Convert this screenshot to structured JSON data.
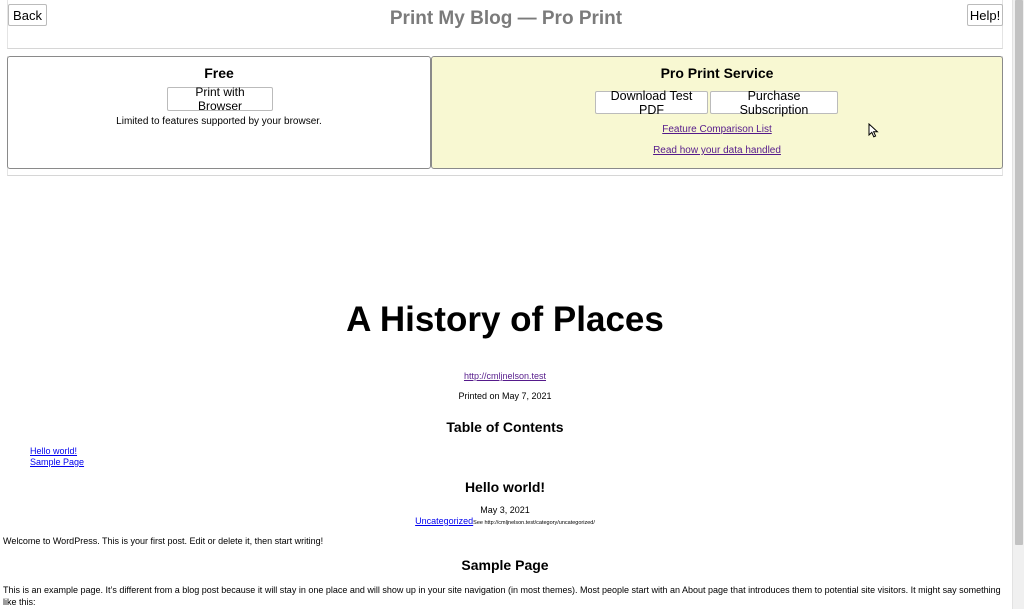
{
  "header": {
    "back_label": "Back",
    "title": "Print My Blog — Pro Print",
    "help_label": "Help!"
  },
  "free_panel": {
    "title": "Free",
    "print_button": "Print with Browser",
    "note": "Limited to features supported by your browser."
  },
  "pro_panel": {
    "title": "Pro Print Service",
    "download_button": "Download Test PDF",
    "purchase_button": "Purchase Subscription",
    "comparison_link": "Feature Comparison List",
    "data_link": "Read how your data handled"
  },
  "document": {
    "title": "A History of Places",
    "site_url": "http://cmljnelson.test",
    "printed_on": "Printed on May 7, 2021",
    "toc_title": "Table of Contents",
    "toc_items": [
      {
        "label": "Hello world!"
      },
      {
        "label": "Sample Page"
      }
    ],
    "post": {
      "title": "Hello world!",
      "date": "May 3, 2021",
      "category": "Uncategorized",
      "category_see": "See http://cmljnelson.test/category/uncategorized/",
      "body": "Welcome to WordPress. This is your first post. Edit or delete it, then start writing!"
    },
    "page": {
      "title": "Sample Page",
      "body": "This is an example page. It’s different from a blog post because it will stay in one place and will show up in your site navigation (in most themes). Most people start with an About page that introduces them to potential site visitors. It might say something like this:"
    }
  },
  "icons": {
    "cursor": "mouse-pointer-icon"
  }
}
